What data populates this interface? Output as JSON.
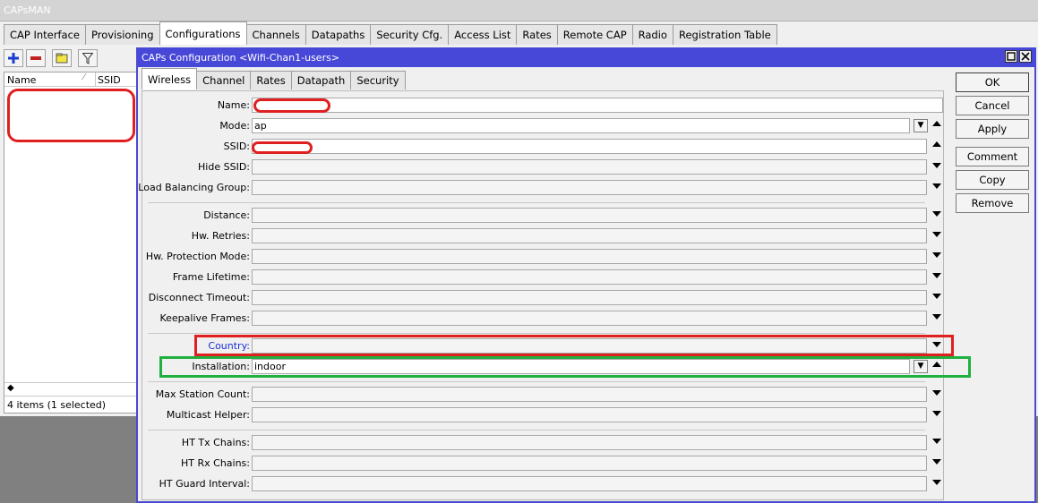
{
  "window": {
    "title": "CAPsMAN"
  },
  "main_tabs": [
    {
      "label": "CAP Interface"
    },
    {
      "label": "Provisioning"
    },
    {
      "label": "Configurations"
    },
    {
      "label": "Channels"
    },
    {
      "label": "Datapaths"
    },
    {
      "label": "Security Cfg."
    },
    {
      "label": "Access List"
    },
    {
      "label": "Rates"
    },
    {
      "label": "Remote CAP"
    },
    {
      "label": "Radio"
    },
    {
      "label": "Registration Table"
    }
  ],
  "active_main_tab": "Configurations",
  "toolbar": {
    "icons": [
      "add-icon",
      "remove-icon",
      "comment-icon",
      "filter-icon"
    ]
  },
  "list": {
    "columns": [
      "Name",
      "SSID"
    ],
    "scroll_glyph": "◆",
    "status": "4 items (1 selected)"
  },
  "dialog": {
    "title": "CAPs Configuration <Wifi-Chan1-users>",
    "tabs": [
      {
        "label": "Wireless"
      },
      {
        "label": "Channel"
      },
      {
        "label": "Rates"
      },
      {
        "label": "Datapath"
      },
      {
        "label": "Security"
      }
    ],
    "active_tab": "Wireless",
    "fields": {
      "name": {
        "label": "Name:",
        "value": ""
      },
      "mode": {
        "label": "Mode:",
        "value": "ap"
      },
      "ssid": {
        "label": "SSID:",
        "value": ""
      },
      "hide_ssid": {
        "label": "Hide SSID:",
        "value": ""
      },
      "load_balancing_group": {
        "label": "Load Balancing Group:",
        "value": ""
      },
      "distance": {
        "label": "Distance:",
        "value": ""
      },
      "hw_retries": {
        "label": "Hw. Retries:",
        "value": ""
      },
      "hw_protection_mode": {
        "label": "Hw. Protection Mode:",
        "value": ""
      },
      "frame_lifetime": {
        "label": "Frame Lifetime:",
        "value": ""
      },
      "disconnect_timeout": {
        "label": "Disconnect Timeout:",
        "value": ""
      },
      "keepalive_frames": {
        "label": "Keepalive Frames:",
        "value": ""
      },
      "country": {
        "label": "Country:",
        "value": ""
      },
      "installation": {
        "label": "Installation:",
        "value": "indoor"
      },
      "max_station_count": {
        "label": "Max Station Count:",
        "value": ""
      },
      "multicast_helper": {
        "label": "Multicast Helper:",
        "value": ""
      },
      "ht_tx_chains": {
        "label": "HT Tx Chains:",
        "value": ""
      },
      "ht_rx_chains": {
        "label": "HT Rx Chains:",
        "value": ""
      },
      "ht_guard_interval": {
        "label": "HT Guard Interval:",
        "value": ""
      }
    },
    "buttons": {
      "ok": "OK",
      "cancel": "Cancel",
      "apply": "Apply",
      "comment": "Comment",
      "copy": "Copy",
      "remove": "Remove"
    }
  },
  "colors": {
    "dialog_title_bar": "#4848d8",
    "highlight_red": "#e02020",
    "highlight_green": "#20b040",
    "country_label": "#1a2ed6"
  }
}
